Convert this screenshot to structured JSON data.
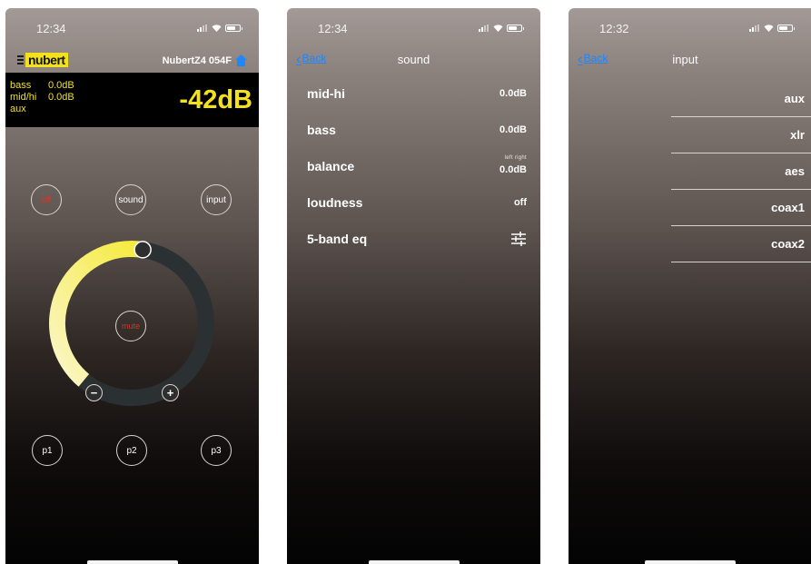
{
  "colors": {
    "accent_yellow": "#f3e21b",
    "link_blue": "#1e86ff",
    "off_red": "#d2362c",
    "home_blue": "#1e86ff"
  },
  "screen1": {
    "time": "12:34",
    "logo_text": "nubert",
    "device_name": "NubertZ4 054F",
    "home_icon": "house-icon",
    "info": {
      "bass_label": "bass",
      "bass_value": "0.0dB",
      "midhi_label": "mid/hi",
      "midhi_value": "0.0dB",
      "input_label": "aux"
    },
    "volume_display": "-42dB",
    "buttons": {
      "off": "off",
      "sound": "sound",
      "input": "input",
      "mute": "mute",
      "minus": "−",
      "plus": "+",
      "p1": "p1",
      "p2": "p2",
      "p3": "p3"
    },
    "volume_fill_fraction": 0.55
  },
  "screen2": {
    "time": "12:34",
    "back_label": "Back",
    "title": "sound",
    "rows": [
      {
        "label": "mid-hi",
        "value": "0.0dB"
      },
      {
        "label": "bass",
        "value": "0.0dB"
      },
      {
        "label": "balance",
        "value": "0.0dB",
        "sub": "left right"
      },
      {
        "label": "loudness",
        "value": "off"
      },
      {
        "label": "5-band eq",
        "icon": "sliders-icon"
      }
    ]
  },
  "screen3": {
    "time": "12:32",
    "back_label": "Back",
    "title": "input",
    "options": [
      "aux",
      "xlr",
      "aes",
      "coax1",
      "coax2"
    ]
  }
}
